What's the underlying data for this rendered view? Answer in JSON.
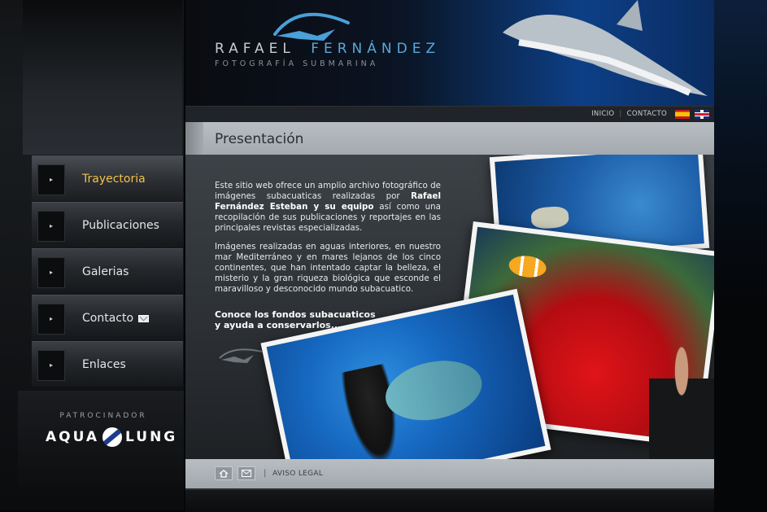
{
  "header": {
    "logo_first": "RAFAEL",
    "logo_last": "FERNÁNDEZ",
    "logo_subtitle": "FOTOGRAFÍA SUBMARINA"
  },
  "topnav": {
    "inicio": "INICIO",
    "contacto": "CONTACTO",
    "separator": "|"
  },
  "nav": {
    "items": [
      {
        "label": "Trayectoria",
        "active": true
      },
      {
        "label": "Publicaciones",
        "active": false
      },
      {
        "label": "Galerias",
        "active": false
      },
      {
        "label": "Contacto",
        "active": false
      },
      {
        "label": "Enlaces",
        "active": false
      }
    ]
  },
  "sponsor": {
    "label": "PATROCINADOR",
    "brand_left": "AQUA",
    "brand_right": "LUNG"
  },
  "page": {
    "title": "Presentación",
    "p1_a": "Este sitio web ofrece un amplio archivo fotográfico de imágenes subacuaticas realizadas por ",
    "p1_bold": "Rafael Fernández Esteban y su equipo",
    "p1_b": " así como una recopilación de sus publicaciones y reportajes en las principales revistas especializadas.",
    "p2": "Imágenes realizadas en aguas interiores, en nuestro mar Mediterráneo y en mares lejanos de los cinco continentes, que han intentado captar la belleza, el misterio y la gran riqueza biológica que esconde el maravilloso y desconocido mundo subacuatico.",
    "cta_line1": "Conoce los fondos subacuaticos",
    "cta_line2": "y ayuda a conservarlos..."
  },
  "footer": {
    "separator": "|",
    "legal": "AVISO LEGAL"
  },
  "colors": {
    "accent_active": "#f0c24a",
    "logo_blue": "#5aa8d8"
  },
  "icons": [
    "home-icon",
    "mail-icon",
    "flag-es-icon",
    "flag-uk-icon",
    "diver-logo-icon",
    "arrow-icon"
  ]
}
